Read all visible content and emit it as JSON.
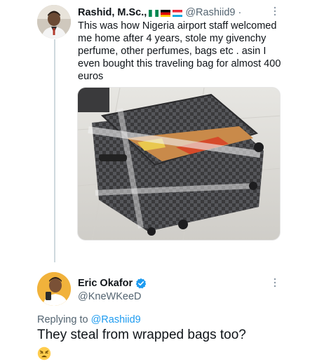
{
  "original_tweet": {
    "author_name": "Rashid, M.Sc.,",
    "author_handle": "@Rashiid9 ·",
    "flags": [
      "nigeria-flag-icon",
      "germany-flag-icon",
      "luxembourg-flag-icon"
    ],
    "text": "This was how Nigeria airport staff welcomed me home after 4 years, stole my givenchy perfume, other perfumes, bags etc . asin I even bought this traveling bag for almost 400 euros",
    "media_icon": "wrapped-suitcase-photo"
  },
  "reply_tweet": {
    "author_name": "Eric Okafor",
    "author_handle": "@KneWKeeD",
    "verified_icon": "verified-badge-icon",
    "replying_prefix": "Replying to",
    "replying_to": "@Rashiid9",
    "text": "They steal from wrapped bags too?",
    "emoji_icon": "weary-face-emoji"
  },
  "colors": {
    "link": "#1d9bf0",
    "secondary_text": "#536471",
    "primary_text": "#0f1419",
    "thread_line": "#cfd9de"
  }
}
